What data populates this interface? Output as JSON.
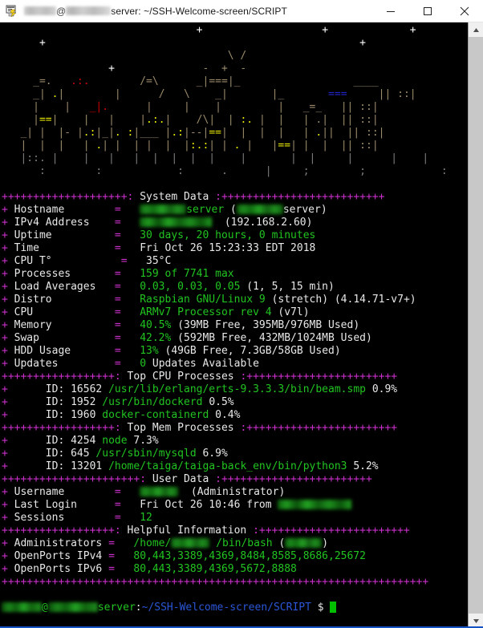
{
  "window": {
    "title_suffix": "server: ~/SSH-Welcome-screen/SCRIPT",
    "at_symbol": "@",
    "icon": "putty-icon",
    "minimize_label": "Minimize",
    "maximize_label": "Maximize",
    "close_label": "Close"
  },
  "terminal": {
    "ascii_art_title": "city-skyline-ascii-art",
    "ascii_art": [
      "                                               +                             +                 +",
      "        +                                                                          +",
      "                                                       \\ /",
      "                                  +                  -  +  -",
      "       _=.          .:.               /=\\           _|===|_                         ____",
      "     _|  .|        _ |.|             /   \\       _|       |_            ___      || ::|",
      "     |    |        | | |             |   |        |       |        ____    -=-  || ::|",
      "     |==|          |   |     ___     |.:.|       /\\|  | :. |      |    |   | .||  :  |||  ::|",
      "   _| |  |-  |.:|_|. : |___  |.:|--|==|  |  |    |  |  | . |   |   |  |||  ::|",
      "   |  |  |   | .| |  | |  |  |:.:| |  . |     |==|  |  |  |   |   |  |||  ::|",
      "   |::. |    |   |   |  |  |  |  |    |       |  |     |      |    |     |   |     |",
      "      :        :            :      .      |     ;        ;            :"
    ],
    "sections": [
      {
        "name": "System Data",
        "prefix": "++++++++++++++++++",
        "suffix": "+++++++++++++++++++++++++++"
      },
      {
        "name": "Top CPU Processes",
        "prefix": "++++++++++++++++",
        "suffix": "++++++++++++++++++++++++"
      },
      {
        "name": "Top Mem Processes",
        "prefix": "++++++++++++++++",
        "suffix": "++++++++++++++++++++++++"
      },
      {
        "name": "User Data",
        "prefix": "++++++++++++++++++++",
        "suffix": "++++++++++++++++++++++++++++"
      },
      {
        "name": "Helpful Information",
        "prefix": "++++++++++++++",
        "suffix": "++++++++++++++++++++++++"
      }
    ],
    "system_data": {
      "hostname": {
        "label": "Hostname",
        "value_suffix": "server",
        "paren_suffix": "server",
        "redacted": true
      },
      "ipv4": {
        "label": "IPv4 Address",
        "public_redacted": true,
        "private": "(192.168.2.60)"
      },
      "uptime": {
        "label": "Uptime",
        "value": "30 days, 20 hours, 0 minutes"
      },
      "time": {
        "label": "Time",
        "value": "Fri Oct 26 15:23:33 EDT 2018"
      },
      "cpu_temp": {
        "label": "CPU T°",
        "value": "35°C"
      },
      "processes": {
        "label": "Processes",
        "value": "159 of 7741 max"
      },
      "load": {
        "label": "Load Averages",
        "value": "0.03, 0.03, 0.05",
        "note": "(1, 5, 15 min)"
      },
      "distro": {
        "label": "Distro",
        "value": "Raspbian GNU/Linux 9",
        "note": "(stretch) (4.14.71-v7+)"
      },
      "cpu": {
        "label": "CPU",
        "value": "ARMv7 Processor rev 4",
        "note": "(v7l)"
      },
      "memory": {
        "label": "Memory",
        "value": "40.5%",
        "note": "(39MB Free, 395MB/976MB Used)"
      },
      "swap": {
        "label": "Swap",
        "value": "42.2%",
        "note": "(592MB Free, 432MB/1024MB Used)"
      },
      "hdd": {
        "label": "HDD Usage",
        "value": "13%",
        "note": "(49GB Free, 7.3GB/58GB Used)"
      },
      "updates": {
        "label": "Updates",
        "value": "0",
        "note": "Updates Available"
      }
    },
    "top_cpu_processes": [
      {
        "id_label": "ID:",
        "pid": "16562",
        "command": "/usr/lib/erlang/erts-9.3.3.3/bin/beam.smp",
        "pct": "0.9%"
      },
      {
        "id_label": "ID:",
        "pid": "1952",
        "command": "/usr/bin/dockerd",
        "pct": "0.5%"
      },
      {
        "id_label": "ID:",
        "pid": "1960",
        "command": "docker-containerd",
        "pct": "0.4%"
      }
    ],
    "top_mem_processes": [
      {
        "id_label": "ID:",
        "pid": "4254",
        "command": "node",
        "pct": "7.3%"
      },
      {
        "id_label": "ID:",
        "pid": "645",
        "command": "/usr/sbin/mysqld",
        "pct": "6.9%"
      },
      {
        "id_label": "ID:",
        "pid": "13201",
        "command": "/home/taiga/taiga-back_env/bin/python3",
        "pct": "5.2%"
      }
    ],
    "user_data": {
      "username": {
        "label": "Username",
        "value_redacted": true,
        "note": "(Administrator)"
      },
      "last_login": {
        "label": "Last Login",
        "value": "Fri Oct 26 10:46 from",
        "ip_redacted": true
      },
      "sessions": {
        "label": "Sessions",
        "value": "12"
      }
    },
    "helpful_information": {
      "administrators": {
        "label": "Administrators",
        "home_prefix": "/home/",
        "shell": "/bin/bash",
        "redacted": true
      },
      "openports_ipv4": {
        "label": "OpenPorts IPv4",
        "value": "80,443,3389,4369,8484,8585,8686,25672"
      },
      "openports_ipv6": {
        "label": "OpenPorts IPv6",
        "value": "80,443,3389,4369,5672,8888"
      }
    },
    "footer_rule": "++++++++++++++++++++++++++++++++++++++++++++++++++++++++++++++++++++",
    "prompt": {
      "at": "@",
      "host_suffix": "server",
      "colon": ":",
      "path": "~/SSH-Welcome-screen/SCRIPT",
      "sigil": "$",
      "cursor": "cursor-block"
    }
  },
  "scrollbar": {
    "up_arrow": "scroll-up-arrow",
    "down_arrow": "scroll-down-arrow",
    "thumb": "scroll-thumb"
  },
  "colors": {
    "magenta": "#cc2fcc",
    "green": "#21c421",
    "white": "#e8e8e8",
    "yellow": "#e8e800",
    "red": "#cc0000",
    "blue": "#2323cc",
    "prompt_blue": "#2b56d8",
    "terminal_bg": "#000000",
    "cursor": "#00c000"
  }
}
